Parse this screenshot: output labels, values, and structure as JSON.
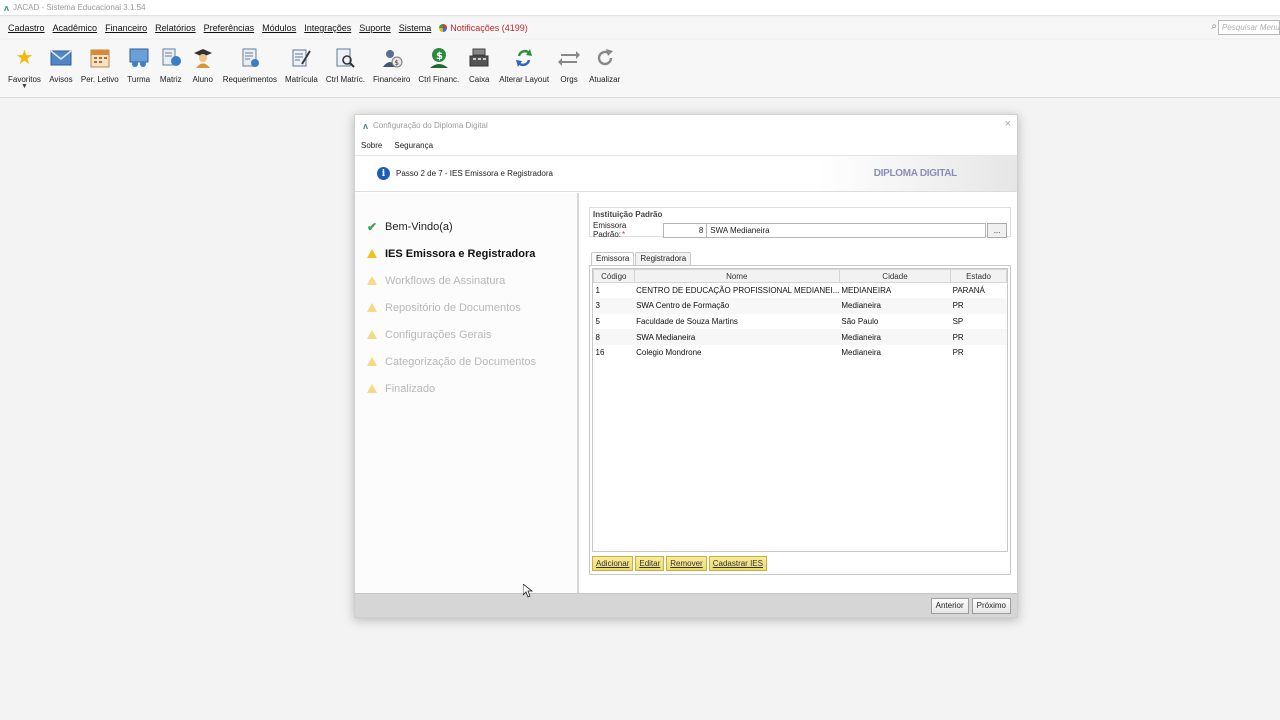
{
  "window": {
    "title": "JACAD - Sistema Educacional 3.1.54"
  },
  "menu": {
    "items": [
      "Cadastro",
      "Acadêmico",
      "Financeiro",
      "Relatórios",
      "Preferências",
      "Módulos",
      "Integrações",
      "Suporte",
      "Sistema"
    ],
    "notifications": "Notificações (4199)",
    "search_placeholder": "Pesquisar Menu"
  },
  "toolbar": [
    {
      "label": "Favoritos",
      "icon": "star-icon"
    },
    {
      "label": "Avisos",
      "icon": "envelope-icon"
    },
    {
      "label": "Per. Letivo",
      "icon": "calendar-icon"
    },
    {
      "label": "Turma",
      "icon": "class-icon"
    },
    {
      "label": "Matriz",
      "icon": "matrix-icon"
    },
    {
      "label": "Aluno",
      "icon": "student-icon"
    },
    {
      "label": "Requerimentos",
      "icon": "request-icon"
    },
    {
      "label": "Matrícula",
      "icon": "enrollment-icon"
    },
    {
      "label": "Ctrl Matríc.",
      "icon": "enrollment-control-icon"
    },
    {
      "label": "Financeiro",
      "icon": "finance-icon"
    },
    {
      "label": "Ctrl Financ.",
      "icon": "finance-control-icon"
    },
    {
      "label": "Caixa",
      "icon": "cash-register-icon"
    },
    {
      "label": "Alterar Layout",
      "icon": "layout-icon"
    },
    {
      "label": "Orgs",
      "icon": "orgs-icon"
    },
    {
      "label": "Atualizar",
      "icon": "refresh-icon"
    }
  ],
  "dialog": {
    "title": "Configuração do Diploma Digital",
    "close": "×",
    "menu": [
      "Sobre",
      "Segurança"
    ],
    "step_text": "Passo 2 de 7 - IES Emissora e Registradora",
    "brand": "DIPLOMA DIGITAL",
    "steps": [
      {
        "label": "Bem-Vindo(a)",
        "status": "done"
      },
      {
        "label": "IES Emissora e Registradora",
        "status": "current"
      },
      {
        "label": "Workflows de Assinatura",
        "status": "pending"
      },
      {
        "label": "Repositório de Documentos",
        "status": "pending"
      },
      {
        "label": "Configurações Gerais",
        "status": "pending"
      },
      {
        "label": "Categorização de Documentos",
        "status": "pending"
      },
      {
        "label": "Finalizado",
        "status": "pending"
      }
    ],
    "group_title": "Instituição Padrão",
    "field_label": "Emissora Padrão:",
    "field_required": "*",
    "field_code": "8",
    "field_name": "SWA Medianeira",
    "lookup": "...",
    "tabs": [
      "Emissora",
      "Registradora"
    ],
    "columns": [
      "Código",
      "Nome",
      "Cidade",
      "Estado"
    ],
    "rows": [
      [
        "1",
        "CENTRO DE EDUCAÇÃO PROFISSIONAL MEDIANEI...",
        "MEDIANEIRA",
        "PARANÁ"
      ],
      [
        "3",
        "SWA Centro de Formação",
        "Medianeira",
        "PR"
      ],
      [
        "5",
        "Faculdade de Souza Martins",
        "São Paulo",
        "SP"
      ],
      [
        "8",
        "SWA Medianeira",
        "Medianeira",
        "PR"
      ],
      [
        "16",
        "Colegio Mondrone",
        "Medianeira",
        "PR"
      ]
    ],
    "actions": [
      "Adicionar",
      "Editar",
      "Remover",
      "Cadastrar IES"
    ],
    "footer": {
      "back": "Anterior",
      "next": "Próximo"
    }
  }
}
